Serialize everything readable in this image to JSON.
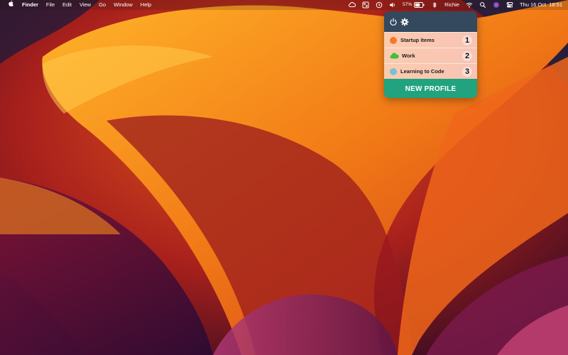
{
  "menubar": {
    "app_name": "Finder",
    "menus": [
      "File",
      "Edit",
      "View",
      "Go",
      "Window",
      "Help"
    ],
    "battery_percent": "57%",
    "user": "Richie",
    "datetime": "Thu 16 Oct  18:51",
    "icons": [
      "apple-logo",
      "creative-cloud-icon",
      "profiles-menu-icon",
      "time-machine-icon",
      "volume-icon",
      "battery-icon",
      "bluetooth-icon",
      "wifi-icon",
      "spotlight-icon",
      "siri-icon",
      "control-center-icon"
    ]
  },
  "popover": {
    "header_icons": [
      "power-icon",
      "gear-icon"
    ],
    "profiles": [
      {
        "label": "Startup items",
        "number": "1",
        "icon": "dot",
        "color": "#f5792a"
      },
      {
        "label": "Work",
        "number": "2",
        "icon": "cloud",
        "color": "#3fc13a"
      },
      {
        "label": "Learning to Code",
        "number": "3",
        "icon": "dot",
        "color": "#78c0d3"
      }
    ],
    "new_profile_label": "NEW PROFILE",
    "colors": {
      "header": "#34485e",
      "row": "#fbcbb0",
      "button": "#21a37f"
    }
  }
}
